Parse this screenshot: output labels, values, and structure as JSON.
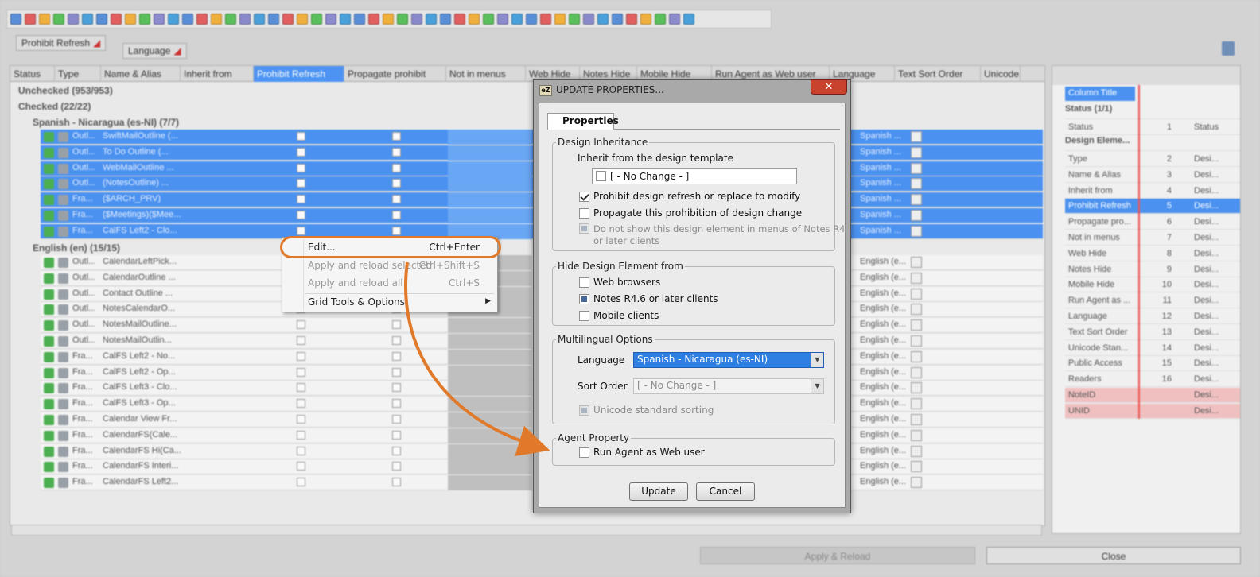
{
  "grid": {
    "group_chips": [
      "Prohibit Refresh",
      "Language"
    ],
    "columns": [
      "Status",
      "Type",
      "Name & Alias",
      "Inherit from",
      "Prohibit Refresh",
      "Propagate prohibit",
      "Not in menus",
      "Web Hide",
      "Notes Hide",
      "Mobile Hide",
      "Run Agent as Web user",
      "Language",
      "Text Sort Order",
      "Unicode"
    ],
    "groups": {
      "unchecked": "Unchecked (953/953)",
      "checked": "Checked (22/22)",
      "spanish": "Spanish - Nicaragua (es-NI) (7/7)",
      "english": "English (en) (15/15)"
    },
    "spanish_rows": [
      {
        "type": "Outl...",
        "name": "SwiftMailOutline (..."
      },
      {
        "type": "Outl...",
        "name": "To Do Outline (..."
      },
      {
        "type": "Outl...",
        "name": "WebMailOutline ..."
      },
      {
        "type": "Outl...",
        "name": "(NotesOutline) ..."
      },
      {
        "type": "Fra...",
        "name": "($ARCH_PRV)"
      },
      {
        "type": "Fra...",
        "name": "($Meetings)($Mee..."
      },
      {
        "type": "Fra...",
        "name": "CalFS Left2 - Clo..."
      }
    ],
    "spanish_lang": "Spanish ...",
    "english_rows": [
      {
        "type": "Outl...",
        "name": "CalendarLeftPick..."
      },
      {
        "type": "Outl...",
        "name": "CalendarOutline ..."
      },
      {
        "type": "Outl...",
        "name": "Contact Outline ..."
      },
      {
        "type": "Outl...",
        "name": "NotesCalendarO..."
      },
      {
        "type": "Outl...",
        "name": "NotesMailOutline..."
      },
      {
        "type": "Outl...",
        "name": "NotesMailOutlin..."
      },
      {
        "type": "Fra...",
        "name": "CalFS Left2 - No..."
      },
      {
        "type": "Fra...",
        "name": "CalFS Left2 - Op..."
      },
      {
        "type": "Fra...",
        "name": "CalFS Left3 - Clo..."
      },
      {
        "type": "Fra...",
        "name": "CalFS Left3 - Op..."
      },
      {
        "type": "Fra...",
        "name": "Calendar View Fr..."
      },
      {
        "type": "Fra...",
        "name": "CalendarFS(Cale..."
      },
      {
        "type": "Fra...",
        "name": "CalendarFS Hi(Ca..."
      },
      {
        "type": "Fra...",
        "name": "CalendarFS Interi..."
      },
      {
        "type": "Fra...",
        "name": "CalendarFS Left2..."
      }
    ],
    "english_lang": "English (e..."
  },
  "right_panel": {
    "header": "Column Title",
    "groups": {
      "status": "Status (1/1)",
      "design": "Design Eleme..."
    },
    "rows": [
      {
        "name": "Status",
        "num": "1",
        "desc": "Status"
      },
      {
        "name": "Type",
        "num": "2",
        "desc": "Desi..."
      },
      {
        "name": "Name & Alias",
        "num": "3",
        "desc": "Desi..."
      },
      {
        "name": "Inherit from",
        "num": "4",
        "desc": "Desi..."
      },
      {
        "name": "Prohibit Refresh",
        "num": "5",
        "desc": "Desi..."
      },
      {
        "name": "Propagate pro...",
        "num": "6",
        "desc": "Desi..."
      },
      {
        "name": "Not in menus",
        "num": "7",
        "desc": "Desi..."
      },
      {
        "name": "Web Hide",
        "num": "8",
        "desc": "Desi..."
      },
      {
        "name": "Notes Hide",
        "num": "9",
        "desc": "Desi..."
      },
      {
        "name": "Mobile Hide",
        "num": "10",
        "desc": "Desi..."
      },
      {
        "name": "Run Agent as ...",
        "num": "11",
        "desc": "Desi..."
      },
      {
        "name": "Language",
        "num": "12",
        "desc": "Desi..."
      },
      {
        "name": "Text Sort Order",
        "num": "13",
        "desc": "Desi..."
      },
      {
        "name": "Unicode Stan...",
        "num": "14",
        "desc": "Desi..."
      },
      {
        "name": "Public Access",
        "num": "15",
        "desc": "Desi..."
      },
      {
        "name": "Readers",
        "num": "16",
        "desc": "Desi..."
      },
      {
        "name": "NoteID",
        "num": "",
        "desc": "Desi..."
      },
      {
        "name": "UNID",
        "num": "",
        "desc": "Desi..."
      }
    ]
  },
  "footer": {
    "apply_reload": "Apply & Reload",
    "close": "Close"
  },
  "context_menu": {
    "items": [
      {
        "label": "Edit...",
        "shortcut": "Ctrl+Enter",
        "enabled": true
      },
      {
        "label": "Apply and reload selected",
        "shortcut": "Ctrl+Shift+S",
        "enabled": false
      },
      {
        "label": "Apply and reload all",
        "shortcut": "Ctrl+S",
        "enabled": false
      },
      {
        "label": "Grid Tools & Options",
        "shortcut": "",
        "enabled": true
      }
    ]
  },
  "dialog": {
    "logo": "eZ",
    "title": "UPDATE PROPERTIES...",
    "close_glyph": "✕",
    "tab": "Properties",
    "design_inheritance": {
      "legend": "Design Inheritance",
      "inherit_label": "Inherit from the design template",
      "inherit_value": "[ - No Change - ]",
      "prohibit_label": "Prohibit design refresh or replace to modify",
      "propagate_label": "Propagate this prohibition of design change",
      "menus_label_1": "Do not show this design element in menus of Notes R4",
      "menus_label_2": "or later clients"
    },
    "hide": {
      "legend": "Hide Design Element from",
      "web": "Web browsers",
      "notes": "Notes R4.6 or later clients",
      "mobile": "Mobile clients"
    },
    "multilingual": {
      "legend": "Multilingual Options",
      "language_label": "Language",
      "language_value": "Spanish - Nicaragua (es-NI)",
      "sort_label": "Sort Order",
      "sort_value": "[ - No Change - ]",
      "unicode_label": "Unicode standard sorting"
    },
    "agent": {
      "legend": "Agent Property",
      "run_label": "Run Agent as Web user"
    },
    "buttons": {
      "update": "Update",
      "cancel": "Cancel"
    }
  },
  "colors": {
    "selection": "#4b92f0",
    "callout": "#e07a2a",
    "close_red": "#c8422e"
  }
}
